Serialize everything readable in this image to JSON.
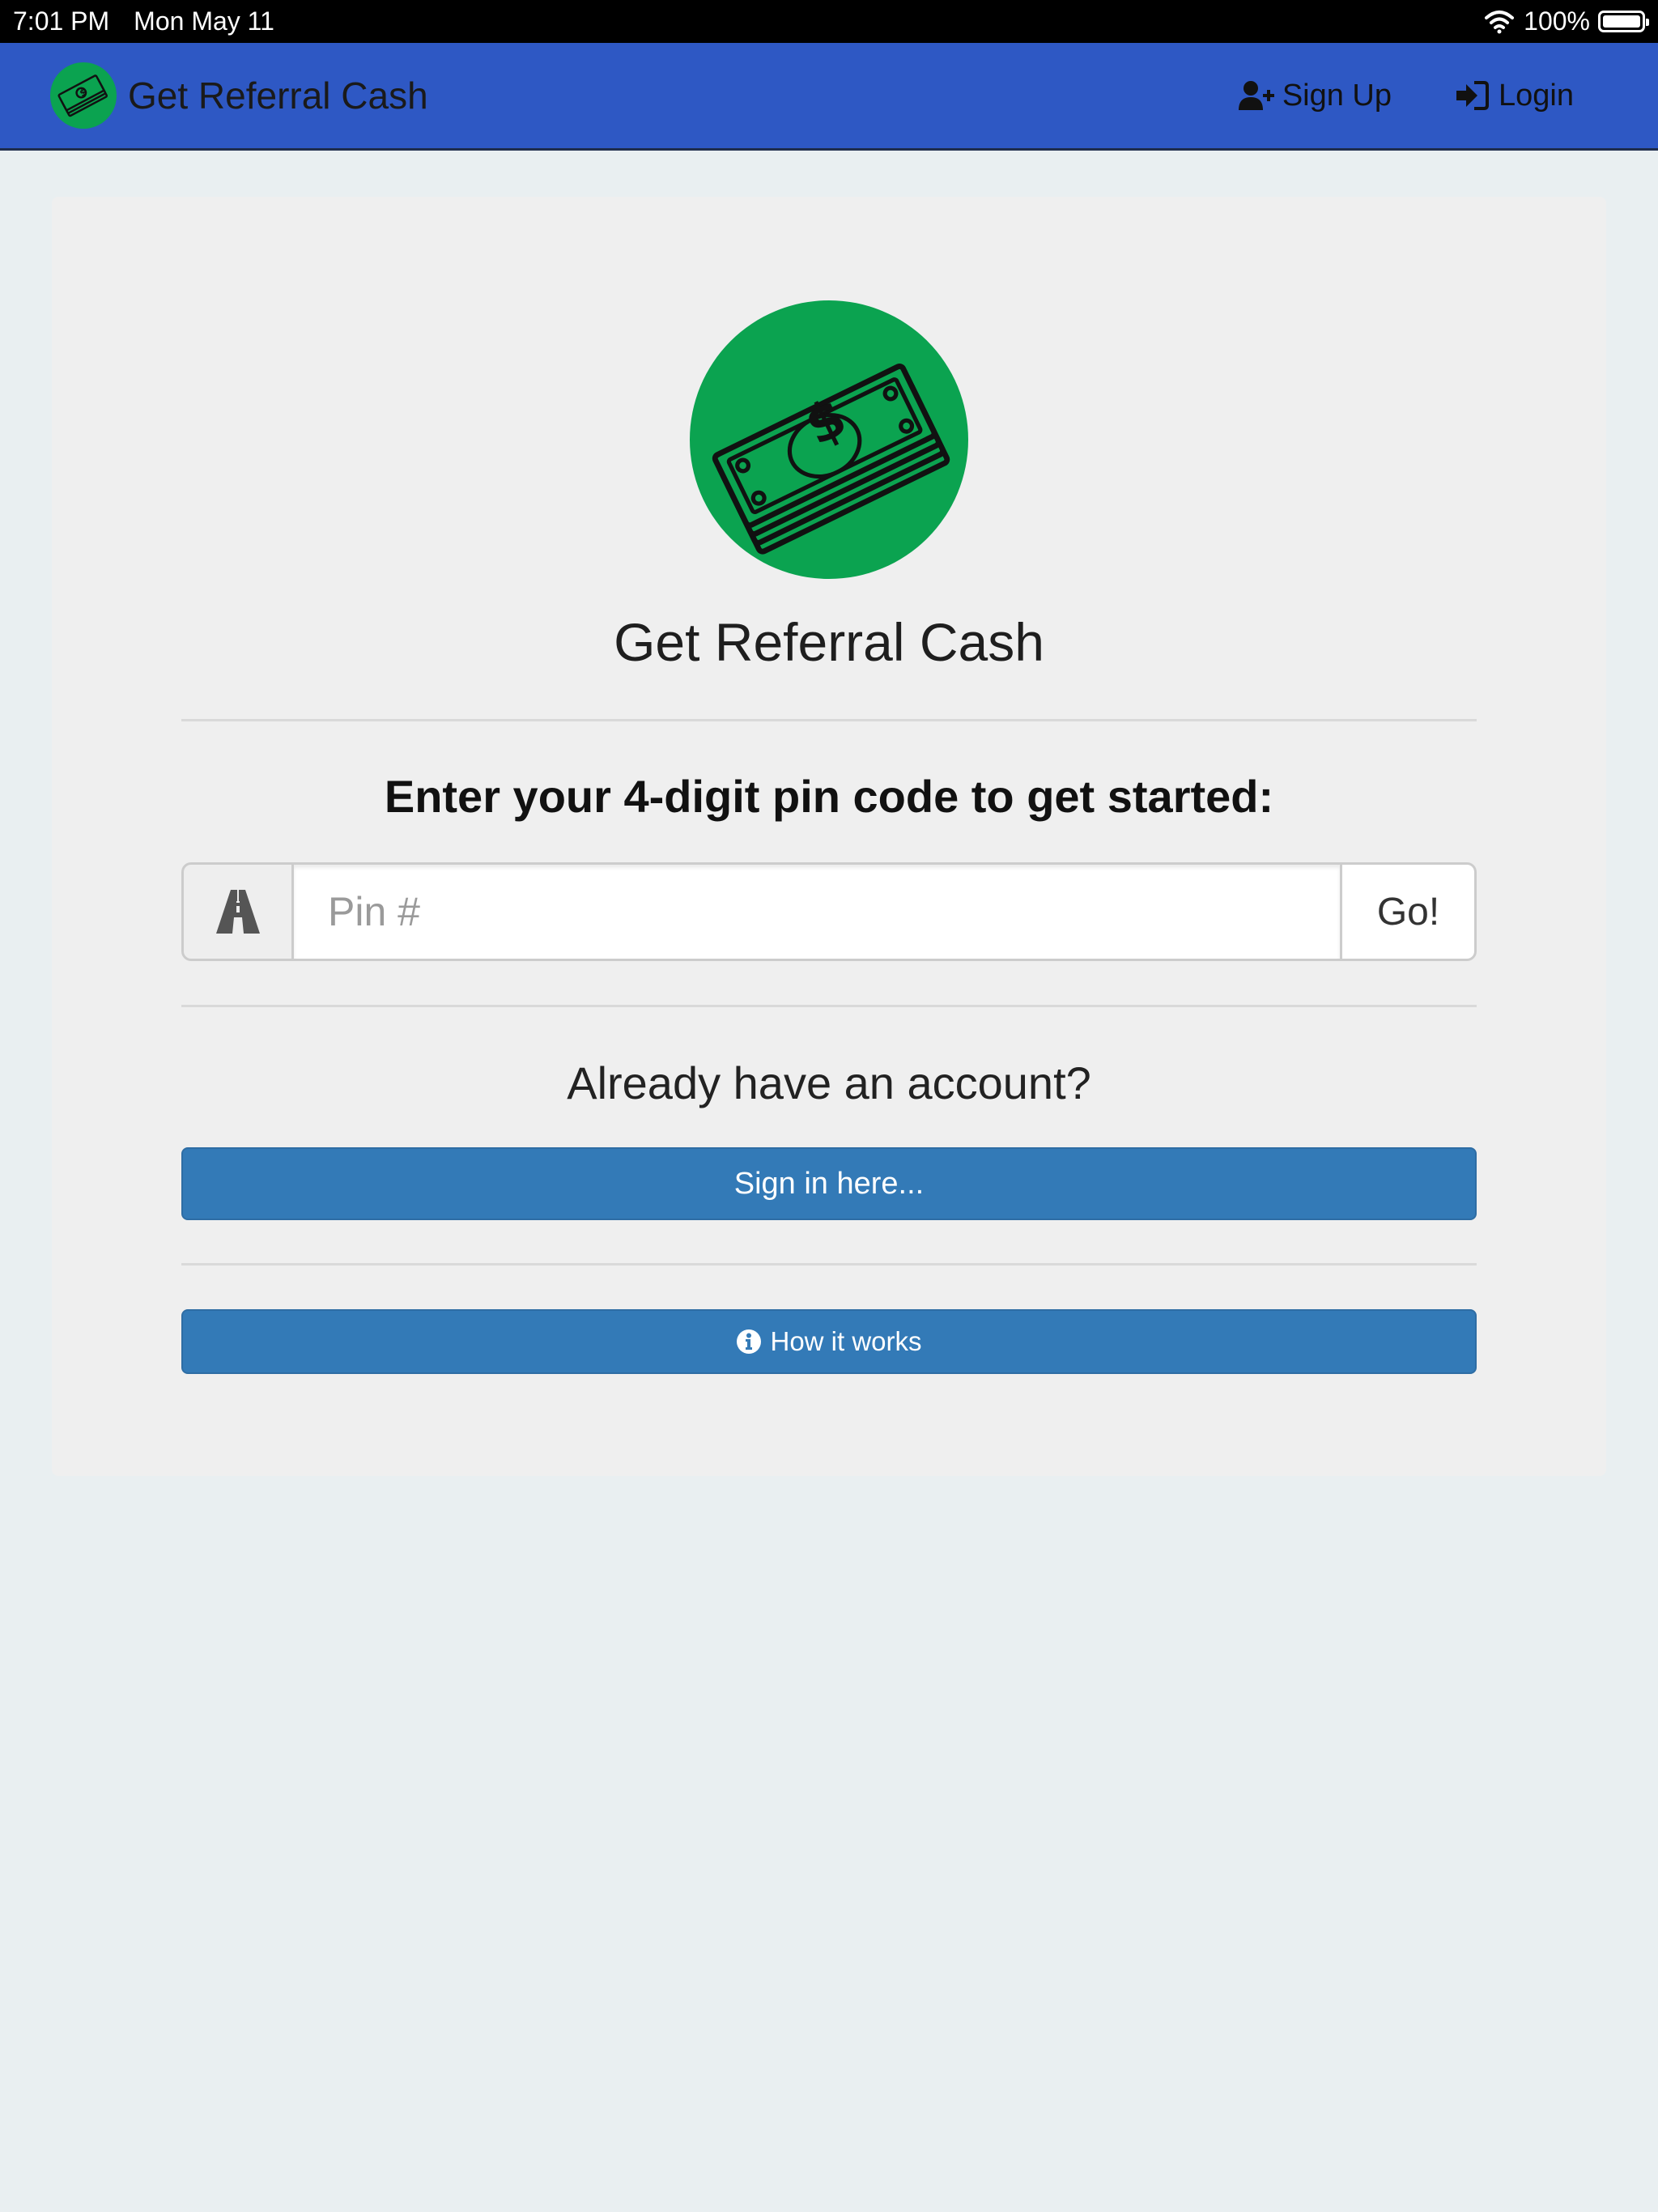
{
  "status_bar": {
    "time": "7:01 PM",
    "date": "Mon May 11",
    "battery": "100%",
    "battery_level": 1.0
  },
  "navbar": {
    "brand": "Get Referral Cash",
    "signup_label": "Sign Up",
    "login_label": "Login"
  },
  "main": {
    "title": "Get Referral Cash",
    "prompt": "Enter your 4-digit pin code to get started:",
    "pin_placeholder": "Pin #",
    "pin_value": "",
    "go_label": "Go!",
    "account_question": "Already have an account?",
    "signin_label": "Sign in here...",
    "how_label": "How it works"
  },
  "colors": {
    "navbar": "#2e58c4",
    "page_bg": "#e9eff1",
    "panel_bg": "#efefef",
    "primary_button": "#337ab7",
    "logo_green": "#0ba350"
  },
  "icons": {
    "brand": "money-logo-icon",
    "signup": "user-plus-icon",
    "login": "sign-in-icon",
    "pin_addon": "road-icon",
    "how": "info-circle-icon",
    "wifi": "wifi-icon",
    "battery": "battery-icon"
  }
}
